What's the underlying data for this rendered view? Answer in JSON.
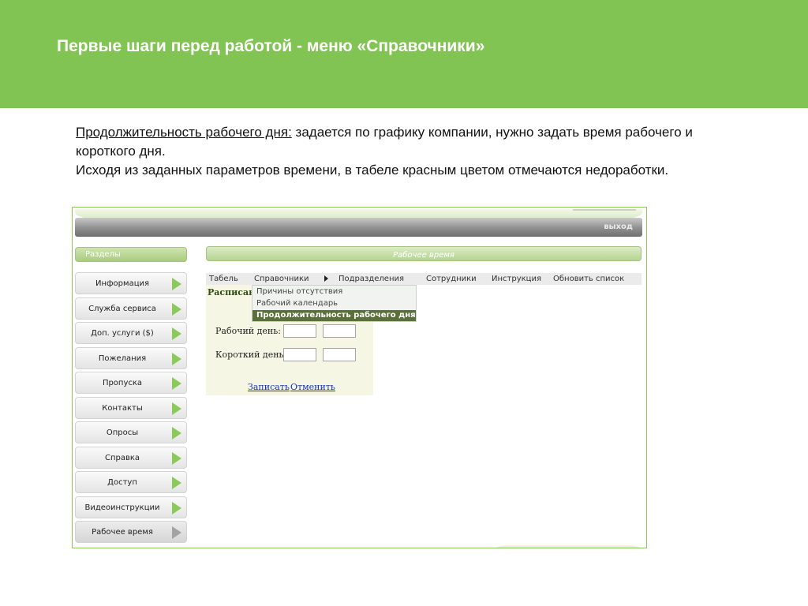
{
  "slide": {
    "title": "Первые шаги перед работой - меню «Справочники»",
    "desc_term": "Продолжительность рабочего дня:",
    "desc_line1_rest": " задается по графику компании, нужно задать время рабочего и короткого дня.",
    "desc_line2": "Исходя из заданных параметров времени, в табеле красным цветом отмечаются недоработки."
  },
  "app": {
    "exit_label": "выход",
    "sections_title": "Разделы",
    "page_title": "Рабочее время",
    "sidebar": [
      {
        "label": "Информация"
      },
      {
        "label": "Служба сервиса"
      },
      {
        "label": "Доп. услуги ($)"
      },
      {
        "label": "Пожелания"
      },
      {
        "label": "Пропуска"
      },
      {
        "label": "Контакты"
      },
      {
        "label": "Опросы"
      },
      {
        "label": "Справка"
      },
      {
        "label": "Доступ"
      },
      {
        "label": "Видеоинструкции"
      },
      {
        "label": "Рабочее время"
      }
    ],
    "menu": {
      "tabel": "Табель",
      "spravochniki": "Справочники",
      "podrazdeleniya": "Подразделения",
      "sotrudniki": "Сотрудники",
      "instrukciya": "Инструкция",
      "obnovit": "Обновить список"
    },
    "dropdown": [
      {
        "label": "Причины отсутствия"
      },
      {
        "label": "Рабочий календарь"
      },
      {
        "label": "Продолжительность рабочего дня"
      }
    ],
    "form": {
      "heading": "Расписани",
      "work_day_label": "Рабочий день:",
      "short_day_label": "Короткий день",
      "work_day_from": "",
      "work_day_to": "",
      "short_day_from": "",
      "short_day_to": "",
      "save_label": "Записать",
      "cancel_label": "Отменить"
    }
  },
  "colors": {
    "header_green": "#82c453",
    "menu_selected": "#59703b",
    "link_blue": "#1a2fb8",
    "arrow_green": "#8bc95a"
  }
}
